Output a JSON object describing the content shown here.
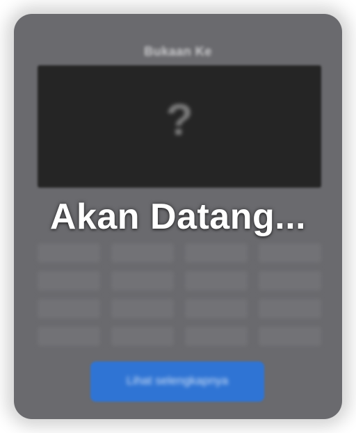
{
  "card": {
    "title": "Bukaan Ke",
    "preview_glyph": "?",
    "overlay_text": "Akan Datang...",
    "cta_label": "Lihat selengkapnya"
  },
  "colors": {
    "card_bg": "#6a6a6e",
    "preview_bg": "#252525",
    "cta_bg": "#2f74d4",
    "overlay_text": "#ffffff"
  }
}
